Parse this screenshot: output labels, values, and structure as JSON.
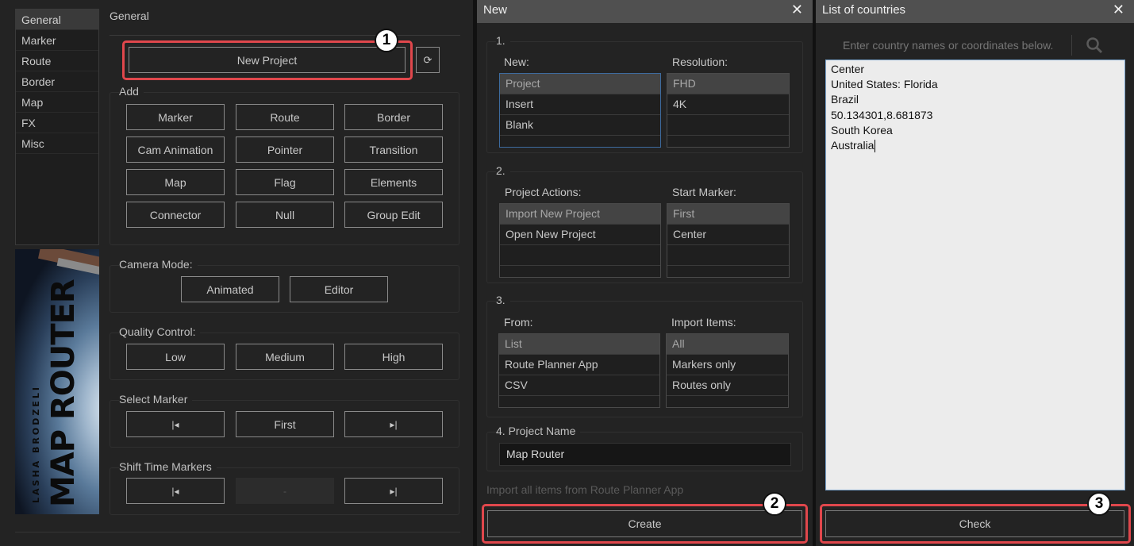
{
  "left": {
    "section_title": "General",
    "sidebar": [
      "General",
      "Marker",
      "Route",
      "Border",
      "Map",
      "FX",
      "Misc"
    ],
    "new_project": "New Project",
    "refresh_icon": "refresh-icon",
    "add": {
      "label": "Add",
      "buttons": [
        "Marker",
        "Route",
        "Border",
        "Cam Animation",
        "Pointer",
        "Transition",
        "Map",
        "Flag",
        "Elements",
        "Connector",
        "Null",
        "Group Edit"
      ]
    },
    "camera": {
      "label": "Camera Mode:",
      "buttons": [
        "Animated",
        "Editor"
      ]
    },
    "quality": {
      "label": "Quality Control:",
      "buttons": [
        "Low",
        "Medium",
        "High"
      ]
    },
    "select_marker": {
      "label": "Select Marker",
      "prev": "|◂",
      "first": "First",
      "next": "▸|"
    },
    "shift_time": {
      "label": "Shift Time Markers",
      "prev": "|◂",
      "mid": "-",
      "next": "▸|"
    },
    "banner": {
      "title": "MAP ROUTER",
      "author": "LASHA BRODZELI"
    }
  },
  "new_dialog": {
    "title": "New",
    "close": "✕",
    "s1": {
      "num": "1.",
      "new_label": "New:",
      "new_items": [
        "Project",
        "Insert",
        "Blank"
      ],
      "res_label": "Resolution:",
      "res_items": [
        "FHD",
        "4K"
      ]
    },
    "s2": {
      "num": "2.",
      "actions_label": "Project Actions:",
      "actions_items": [
        "Import New Project",
        "Open New Project"
      ],
      "start_label": "Start Marker:",
      "start_items": [
        "First",
        "Center"
      ]
    },
    "s3": {
      "num": "3.",
      "from_label": "From:",
      "from_items": [
        "List",
        "Route Planner App",
        "CSV"
      ],
      "import_label": "Import Items:",
      "import_items": [
        "All",
        "Markers only",
        "Routes only"
      ]
    },
    "s4": {
      "label": "4. Project Name",
      "value": "Map Router"
    },
    "hint": "Import all items from Route Planner App",
    "create": "Create"
  },
  "countries_dialog": {
    "title": "List of countries",
    "close": "✕",
    "search_placeholder": "Enter country names or coordinates below.",
    "lines": [
      "Center",
      "United States: Florida",
      "Brazil",
      "50.134301,8.681873",
      "South Korea",
      "Australia"
    ],
    "check": "Check"
  },
  "badges": [
    "1",
    "2",
    "3"
  ],
  "colors": {
    "highlight": "#e0474c",
    "panel_bg": "#232323",
    "titlebar": "#505050"
  }
}
